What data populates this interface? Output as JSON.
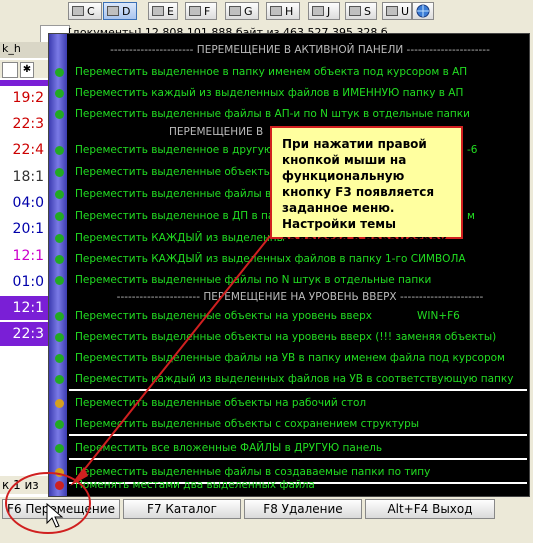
{
  "drives": [
    {
      "label": "C",
      "selected": false
    },
    {
      "label": "D",
      "selected": true
    },
    {
      "label": "E",
      "selected": false
    },
    {
      "label": "F",
      "selected": false
    },
    {
      "label": "G",
      "selected": false
    },
    {
      "label": "H",
      "selected": false
    },
    {
      "label": "J",
      "selected": false
    },
    {
      "label": "S",
      "selected": false
    },
    {
      "label": "U",
      "selected": false
    }
  ],
  "path_info": "[документы] 12 808 101 888 байт из 463 527 395 328 б",
  "left_panel": {
    "path_fragment": "k_h",
    "times": [
      {
        "text": "19:2",
        "color": "#cc0000"
      },
      {
        "text": "22:3",
        "color": "#cc0000"
      },
      {
        "text": "22:4",
        "color": "#cc0000"
      },
      {
        "text": "18:1",
        "color": "#333333"
      },
      {
        "text": "04:0",
        "color": "#0000aa"
      },
      {
        "text": "20:1",
        "color": "#0000aa"
      },
      {
        "text": "12:1",
        "color": "#cc00cc"
      },
      {
        "text": "01:0",
        "color": "#0000aa"
      },
      {
        "text": "12:1",
        "color": "#ffffff"
      },
      {
        "text": "22:3",
        "color": "#ffffff"
      }
    ],
    "status_fragment": "к 1 из"
  },
  "menu": {
    "headers": [
      "---------------------- ПЕРЕМЕЩЕНИЕ В АКТИВНОЙ ПАНЕЛИ ----------------------",
      "ПЕРЕМЕЩЕНИЕ В",
      "---------------------- ПЕРЕМЕЩЕНИЕ НА УРОВЕНЬ ВВЕРХ ----------------------"
    ],
    "items_a": [
      "Переместить выделенное в папку именем объекта под курсором в АП",
      "Переместить каждый из выделенных файлов в ИМЕННУЮ папку в АП",
      "Переместить выделенные файлы в АП-и по N штук в отдельные папки"
    ],
    "items_b": [
      "Переместить выделенное в другую",
      "Переместить выделенные объекты в",
      "Переместить выделенные файлы в другую",
      "Переместить выделенное в ДП в па",
      "Переместить КАЖДЫЙ из выделенны",
      "Переместить КАЖДЫЙ из выделенных файлов в папку 1-го СИМВОЛА",
      "Переместить выделенные файлы по N штук в отдельные папки"
    ],
    "items_b_tail": [
      "-6",
      "м"
    ],
    "items_c": [
      "Переместить выделенные объекты на уровень вверх",
      "Переместить выделенные объекты на уровень вверх (!!! заменяя объекты)",
      "Переместить выделенные файлы на УВ в папку именем файла под курсором",
      "Переместить каждый из выделенных файлов на УВ в соответствующую папку"
    ],
    "hotkey": "WIN+F6",
    "items_d": [
      "Переместить выделенные объекты на рабочий стол",
      "Переместить выделенные объекты с сохранением структуры"
    ],
    "item_e": "Переместить все вложенные ФАЙЛЫ в ДРУГУЮ панель",
    "item_f": "Переместить выделенные файлы в создаваемые папки по типу",
    "item_g": "Поменять местами два выделенных файла"
  },
  "tooltip": {
    "text": "При нажатии правой кнопкой мыши на функциональную кнопку F3 появляется заданное меню. Настройки темы задаются в параметрах"
  },
  "function_keys": [
    {
      "label": "F6 Перемещение"
    },
    {
      "label": "F7 Каталог"
    },
    {
      "label": "F8 Удаление"
    },
    {
      "label": "Alt+F4 Выход"
    }
  ],
  "colors": {
    "menu_bg": "#000000",
    "menu_text": "#22dd22",
    "menu_header": "#bbbbbb",
    "tooltip_bg": "#ffff9f",
    "annotation": "#d02020"
  }
}
